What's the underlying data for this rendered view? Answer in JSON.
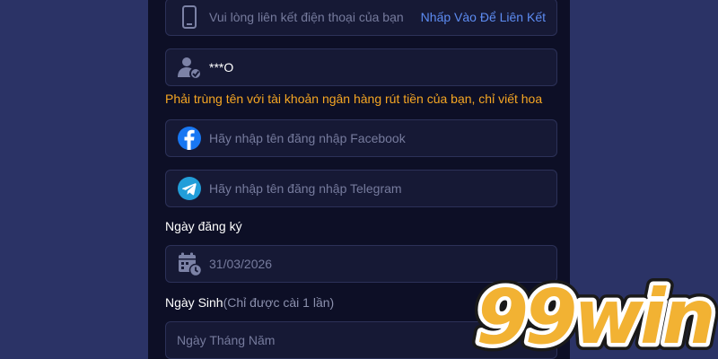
{
  "phone": {
    "placeholder": "Vui lòng liên kết điện thoại của bạn",
    "link": "Nhấp Vào Để Liên Kết"
  },
  "name": {
    "value": "***O",
    "warning": "Phải trùng tên với tài khoản ngân hàng rút tiền của bạn, chỉ viết hoa"
  },
  "facebook": {
    "placeholder": "Hãy nhập tên đăng nhập Facebook"
  },
  "telegram": {
    "placeholder": "Hãy nhập tên đăng nhập Telegram"
  },
  "register_date": {
    "label": "Ngày đăng ký",
    "value": "31/03/2026"
  },
  "birthday": {
    "label": "Ngày Sinh",
    "note": "(Chỉ được cài 1 lần)",
    "placeholder": "Ngày Tháng Năm"
  },
  "logo": {
    "text": "99win"
  },
  "colors": {
    "page_bg": "#2b3366",
    "panel_bg": "#0d0f26",
    "field_bg": "#161935",
    "warning": "#f5a623",
    "link": "#5d8cf2",
    "facebook": "#1877f2",
    "telegram": "#229ed9",
    "logo_fill": "#f2b233",
    "logo_outline": "#ffffff"
  },
  "icons": [
    "phone-icon",
    "user-check-icon",
    "facebook-icon",
    "telegram-icon",
    "calendar-clock-icon"
  ]
}
